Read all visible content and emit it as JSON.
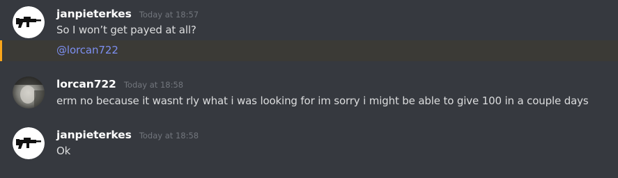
{
  "messages": [
    {
      "username": "janpieterkes",
      "timestamp": "Today at 18:57",
      "avatar_icon": "rifle-icon",
      "lines": [
        "So I won’t get payed at all?"
      ],
      "mention": "@lorcan722"
    },
    {
      "username": "lorcan722",
      "timestamp": "Today at 18:58",
      "avatar_icon": "photo-avatar",
      "lines": [
        "erm no because it wasnt rly what i was looking for im sorry i might be able to give 100 in a couple days"
      ]
    },
    {
      "username": "janpieterkes",
      "timestamp": "Today at 18:58",
      "avatar_icon": "rifle-icon",
      "lines": [
        "Ok"
      ]
    }
  ],
  "colors": {
    "background": "#36393f",
    "mention_highlight": "#faa61a",
    "mention_text": "#7d8ff0"
  }
}
